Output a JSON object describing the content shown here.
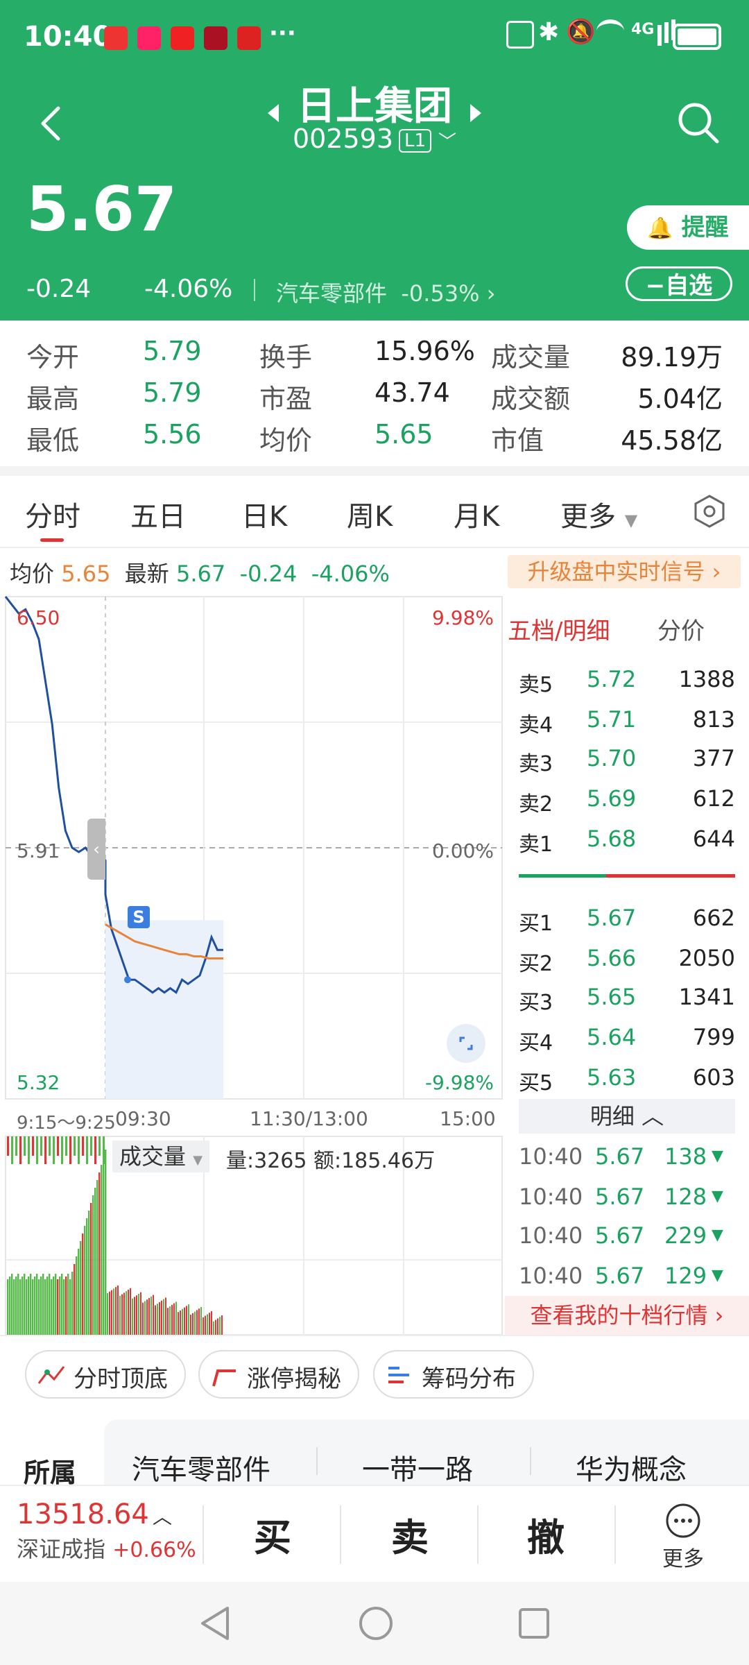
{
  "status_bar": {
    "time": "10:40",
    "dots": "···",
    "network": "4G"
  },
  "header": {
    "title": "日上集团",
    "code": "002593",
    "level": "L1",
    "price": "5.67",
    "change": "-0.24",
    "change_pct": "-4.06%",
    "sector": "汽车零部件",
    "sector_pct": "-0.53%",
    "remind_label": "提醒",
    "watch_label": "自选"
  },
  "stats": [
    {
      "label": "今开",
      "value": "5.79"
    },
    {
      "label": "换手",
      "value": "15.96%"
    },
    {
      "label": "成交量",
      "value": "89.19万"
    },
    {
      "label": "最高",
      "value": "5.79"
    },
    {
      "label": "市盈",
      "value": "43.74"
    },
    {
      "label": "成交额",
      "value": "5.04亿"
    },
    {
      "label": "最低",
      "value": "5.56"
    },
    {
      "label": "均价",
      "value": "5.65"
    },
    {
      "label": "市值",
      "value": "45.58亿"
    }
  ],
  "tabs": [
    "分时",
    "五日",
    "日K",
    "周K",
    "月K",
    "更多"
  ],
  "chart_info": {
    "avg_label": "均价",
    "avg_value": "5.65",
    "latest_label": "最新",
    "latest_value": "5.67",
    "latest_change": "-0.24",
    "latest_pct": "-4.06%",
    "upgrade_label": "升级盘中实时信号 ›",
    "y_top": "6.50",
    "y_mid": "5.91",
    "y_bottom": "5.32",
    "pct_top": "9.98%",
    "pct_mid": "0.00%",
    "pct_bottom": "-9.98%",
    "x_labels": [
      "9:15～9:25",
      "09:30",
      "11:30/13:00",
      "15:00"
    ],
    "s_marker": "S",
    "volume_label": "成交量",
    "volume_info": "量:3265 额:185.46万"
  },
  "chart_data": {
    "type": "line",
    "ylim": [
      5.32,
      6.5
    ],
    "series": [
      {
        "values": [
          6.5,
          6.48,
          6.46,
          6.47,
          6.44,
          6.4,
          6.3,
          6.2,
          6.05,
          5.95,
          5.91,
          5.9,
          5.91,
          5.89,
          5.9,
          5.88,
          5.8,
          5.72,
          5.68,
          5.64,
          5.6,
          5.6,
          5.59,
          5.58,
          5.57,
          5.58,
          5.57,
          5.58,
          5.57,
          5.6,
          5.59,
          5.6,
          5.61,
          5.65,
          5.7,
          5.67,
          5.67
        ]
      },
      {
        "values": [
          5.73,
          5.72,
          5.71,
          5.7,
          5.69,
          5.685,
          5.68,
          5.675,
          5.67,
          5.665,
          5.66,
          5.66,
          5.655,
          5.655,
          5.65,
          5.65,
          5.65
        ]
      }
    ]
  },
  "orderbook": {
    "tab1": "五档/明细",
    "tab2": "分价",
    "sells": [
      {
        "label": "卖5",
        "price": "5.72",
        "vol": "1388"
      },
      {
        "label": "卖4",
        "price": "5.71",
        "vol": "813"
      },
      {
        "label": "卖3",
        "price": "5.70",
        "vol": "377"
      },
      {
        "label": "卖2",
        "price": "5.69",
        "vol": "612"
      },
      {
        "label": "卖1",
        "price": "5.68",
        "vol": "644"
      }
    ],
    "buys": [
      {
        "label": "买1",
        "price": "5.67",
        "vol": "662"
      },
      {
        "label": "买2",
        "price": "5.66",
        "vol": "2050"
      },
      {
        "label": "买3",
        "price": "5.65",
        "vol": "1341"
      },
      {
        "label": "买4",
        "price": "5.64",
        "vol": "799"
      },
      {
        "label": "买5",
        "price": "5.63",
        "vol": "603"
      }
    ],
    "detail_label": "明细",
    "ticks": [
      {
        "time": "10:40",
        "price": "5.67",
        "vol": "138"
      },
      {
        "time": "10:40",
        "price": "5.67",
        "vol": "128"
      },
      {
        "time": "10:40",
        "price": "5.67",
        "vol": "229"
      },
      {
        "time": "10:40",
        "price": "5.67",
        "vol": "129"
      }
    ],
    "more_label": "查看我的十档行情 ›"
  },
  "indicators": [
    "分时顶底",
    "涨停揭秘",
    "筹码分布"
  ],
  "concepts": {
    "label": "所属",
    "items": [
      "汽车零部件",
      "一带一路",
      "华为概念"
    ]
  },
  "bottom": {
    "index_value": "13518.64",
    "index_name": "深证成指",
    "index_pct": "+0.66%",
    "buy": "买",
    "sell": "卖",
    "cancel": "撤",
    "more": "更多"
  },
  "colors": {
    "green": "#26ad68",
    "red": "#e03434",
    "down": "#1aa260",
    "line": "#1f4fa0",
    "avg": "#e8843a"
  }
}
